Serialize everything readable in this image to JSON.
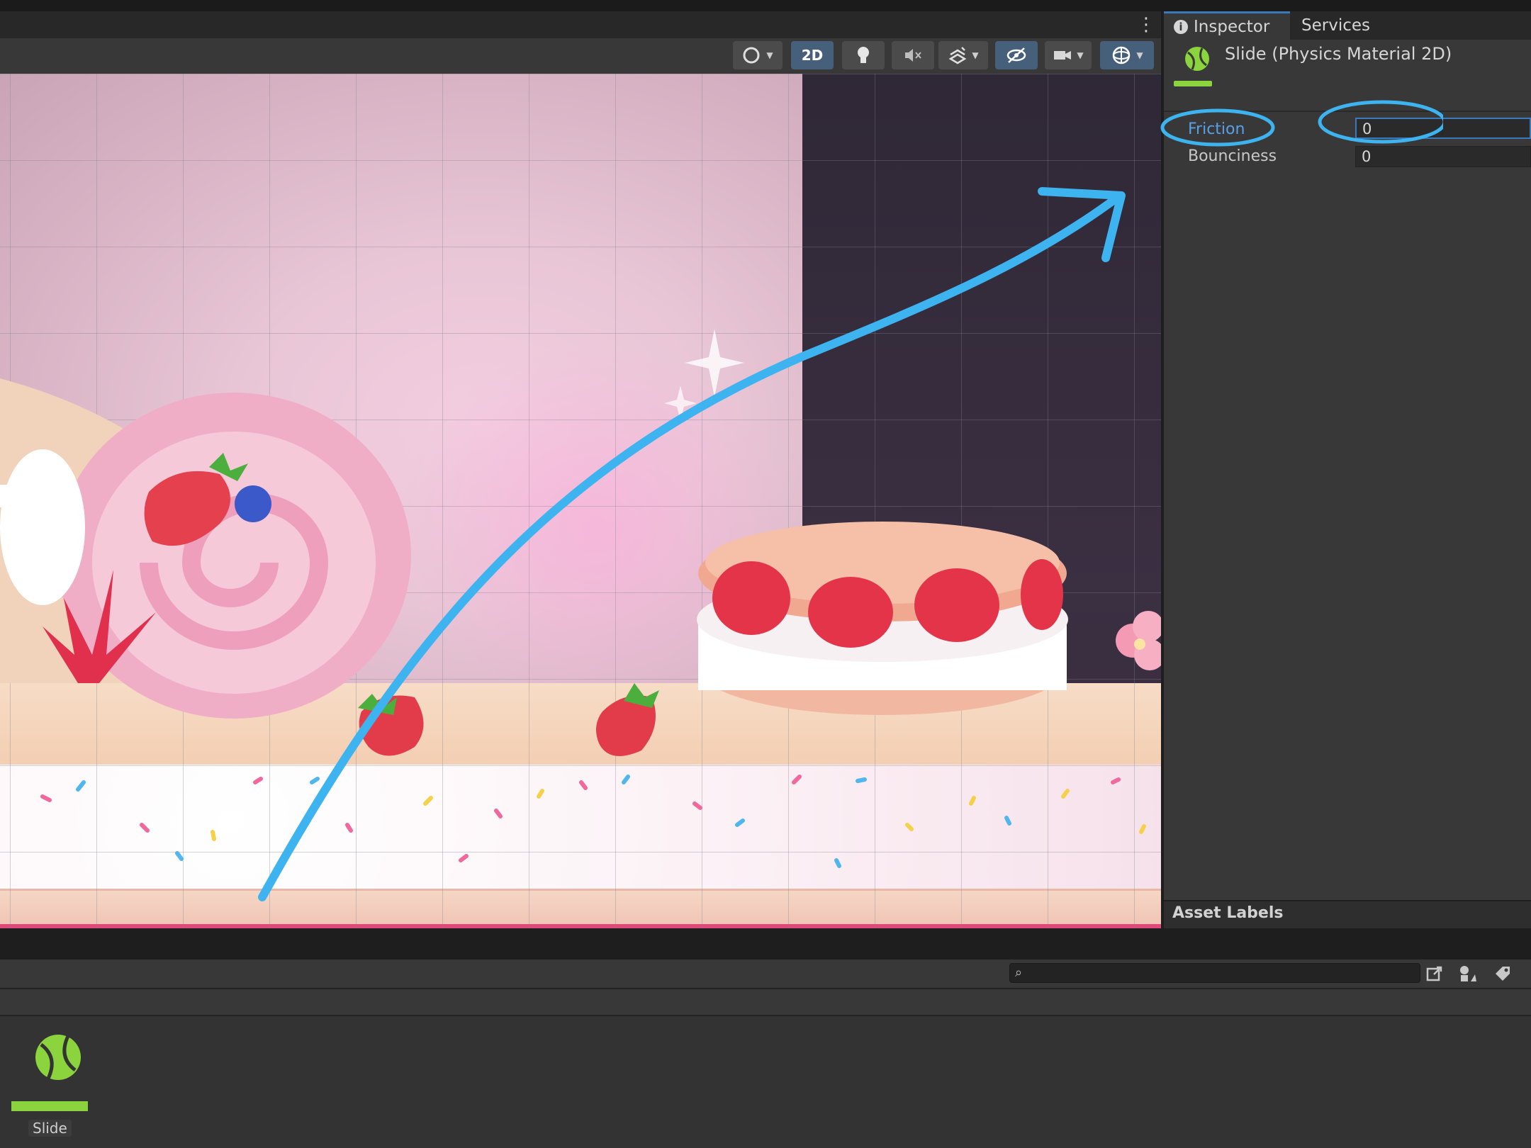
{
  "scene_toolbar": {
    "mode_2d_label": "2D",
    "icons": [
      "shading-mode-icon",
      "2d-toggle",
      "lighting-icon",
      "audio-mute-icon",
      "effects-icon",
      "visibility-icon",
      "camera-icon",
      "gizmos-icon"
    ]
  },
  "inspector": {
    "tabs": [
      {
        "label": "Inspector",
        "active": true
      },
      {
        "label": "Services",
        "active": false
      }
    ],
    "asset_title": "Slide (Physics Material 2D)",
    "properties": [
      {
        "label": "Friction",
        "value": "0"
      },
      {
        "label": "Bounciness",
        "value": "0"
      }
    ],
    "asset_labels_heading": "Asset Labels"
  },
  "project": {
    "search": {
      "value": "",
      "placeholder": ""
    },
    "assets": [
      {
        "label": "Slide",
        "icon": "physics-material-icon",
        "color": "#8bd43d"
      }
    ]
  },
  "annotations": {
    "color": "#3db3f0",
    "items": [
      "friction-label-circle",
      "friction-field-circle",
      "curved-arrow"
    ]
  }
}
